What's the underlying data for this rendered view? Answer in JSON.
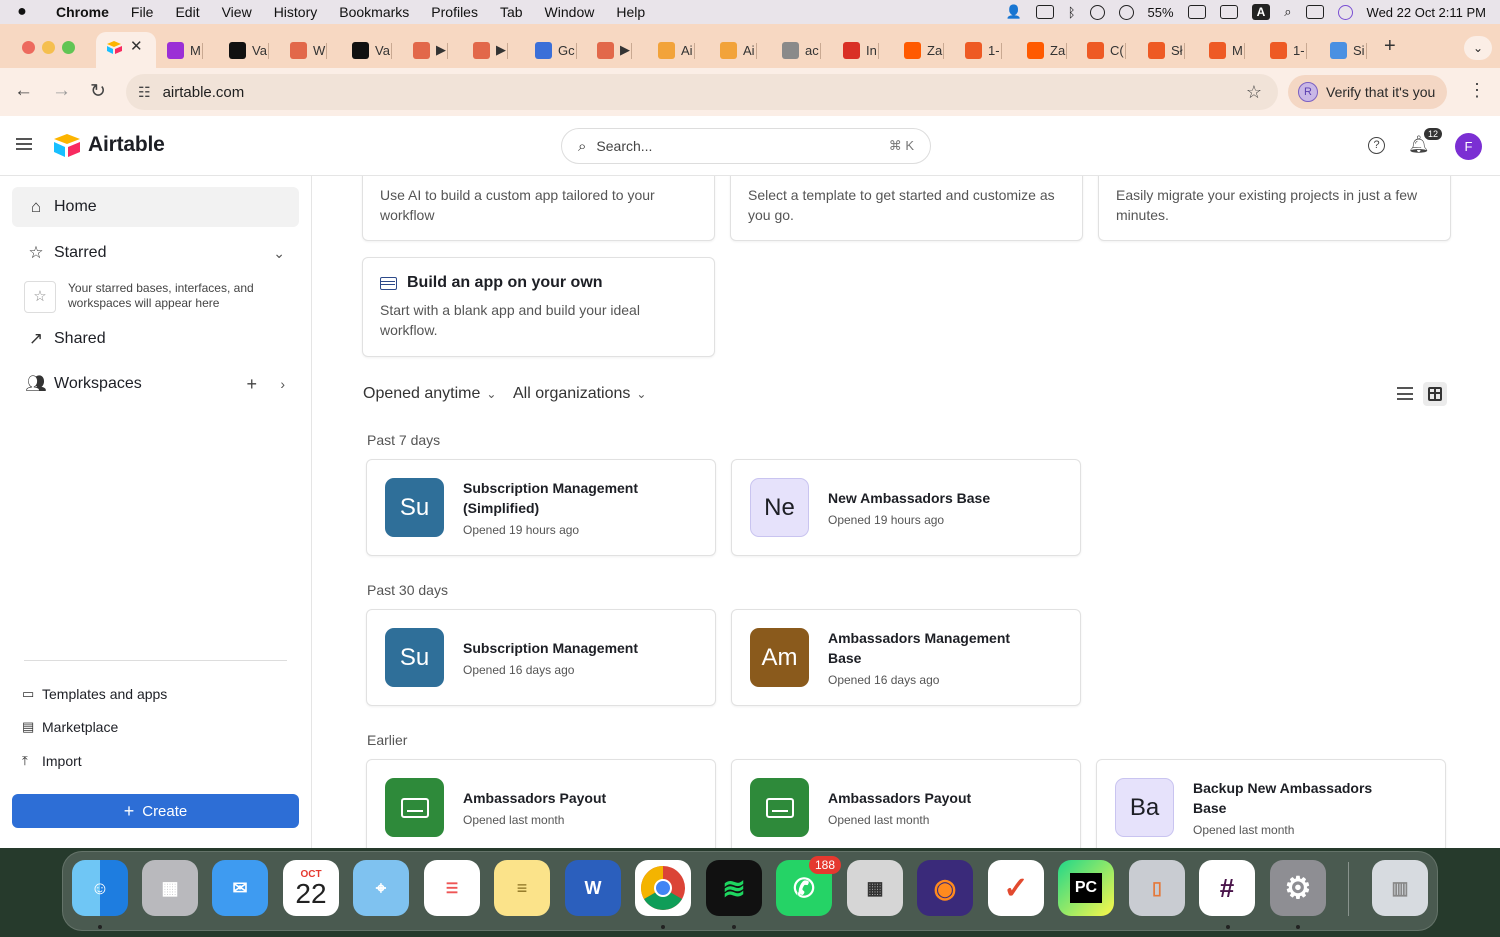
{
  "menubar": {
    "app": "Chrome",
    "items": [
      "File",
      "Edit",
      "View",
      "History",
      "Bookmarks",
      "Profiles",
      "Tab",
      "Window",
      "Help"
    ],
    "battery": "55%",
    "keyboard": "A",
    "datetime": "Wed 22 Oct  2:11 PM"
  },
  "tabs": [
    {
      "label": "M",
      "color": "#9b2fd6"
    },
    {
      "label": "Va",
      "color": "#111111"
    },
    {
      "label": "W",
      "color": "#e2684a"
    },
    {
      "label": "Va",
      "color": "#111111"
    },
    {
      "label": "▶",
      "color": "#e2684a"
    },
    {
      "label": "▶",
      "color": "#e2684a"
    },
    {
      "label": "Gc",
      "color": "#3b6fd8"
    },
    {
      "label": "▶",
      "color": "#e2684a"
    },
    {
      "label": "Ai",
      "color": "#f2a33a"
    },
    {
      "label": "Ai",
      "color": "#f2a33a"
    },
    {
      "label": "ac",
      "color": "#8a8a8a"
    },
    {
      "label": "In",
      "color": "#d93025"
    },
    {
      "label": "Za",
      "color": "#ff5a00"
    },
    {
      "label": "1-",
      "color": "#ee5a24"
    },
    {
      "label": "Za",
      "color": "#ff5a00"
    },
    {
      "label": "C(",
      "color": "#ee5a24"
    },
    {
      "label": "Sł",
      "color": "#ee5a24"
    },
    {
      "label": "M",
      "color": "#ee5a24"
    },
    {
      "label": "1-",
      "color": "#ee5a24"
    },
    {
      "label": "Si",
      "color": "#4a90e2"
    }
  ],
  "toolbar": {
    "url": "airtable.com",
    "verify_label": "Verify that it's you",
    "verify_avatar": "R"
  },
  "header": {
    "logo_text": "Airtable",
    "search_placeholder": "Search...",
    "search_shortcut": "⌘ K",
    "notif_count": "12",
    "avatar_letter": "F"
  },
  "sidebar": {
    "home": "Home",
    "starred": "Starred",
    "starred_hint": "Your starred bases, interfaces, and workspaces will appear here",
    "shared": "Shared",
    "workspaces": "Workspaces",
    "templates": "Templates and apps",
    "marketplace": "Marketplace",
    "import": "Import",
    "create": "Create"
  },
  "start_cards": [
    {
      "title": "",
      "desc": "Use AI to build a custom app tailored to your workflow"
    },
    {
      "title": "",
      "desc": "Select a template to get started and customize as you go."
    },
    {
      "title": "",
      "desc": "Easily migrate your existing projects in just a few minutes."
    },
    {
      "title": "Build an app on your own",
      "desc": "Start with a blank app and build your ideal workflow."
    }
  ],
  "filters": {
    "time": "Opened anytime",
    "org": "All organizations"
  },
  "sections": [
    {
      "label": "Past 7 days",
      "bases": [
        {
          "initials": "Su",
          "name": "Subscription Management (Simplified)",
          "opened": "Opened 19 hours ago",
          "color": "#2f6f99"
        },
        {
          "initials": "Ne",
          "name": "New Ambassadors Base",
          "opened": "Opened 19 hours ago",
          "color": "#e6e2fb"
        }
      ]
    },
    {
      "label": "Past 30 days",
      "bases": [
        {
          "initials": "Su",
          "name": "Subscription Management",
          "opened": "Opened 16 days ago",
          "color": "#2f6f99"
        },
        {
          "initials": "Am",
          "name": "Ambassadors Management Base",
          "opened": "Opened 16 days ago",
          "color": "#8a5a1c"
        }
      ]
    },
    {
      "label": "Earlier",
      "bases": [
        {
          "initials": "",
          "name": "Ambassadors Payout",
          "opened": "Opened last month",
          "color": "#2e8a3a"
        },
        {
          "initials": "",
          "name": "Ambassadors Payout",
          "opened": "Opened last month",
          "color": "#2e8a3a"
        },
        {
          "initials": "Ba",
          "name": "Backup New Ambassadors Base",
          "opened": "Opened last month",
          "color": "#e6e2fb"
        }
      ]
    }
  ],
  "dock": {
    "calendar_month": "OCT",
    "calendar_day": "22",
    "whatsapp_badge": "188",
    "pycharm_label": "PC"
  }
}
